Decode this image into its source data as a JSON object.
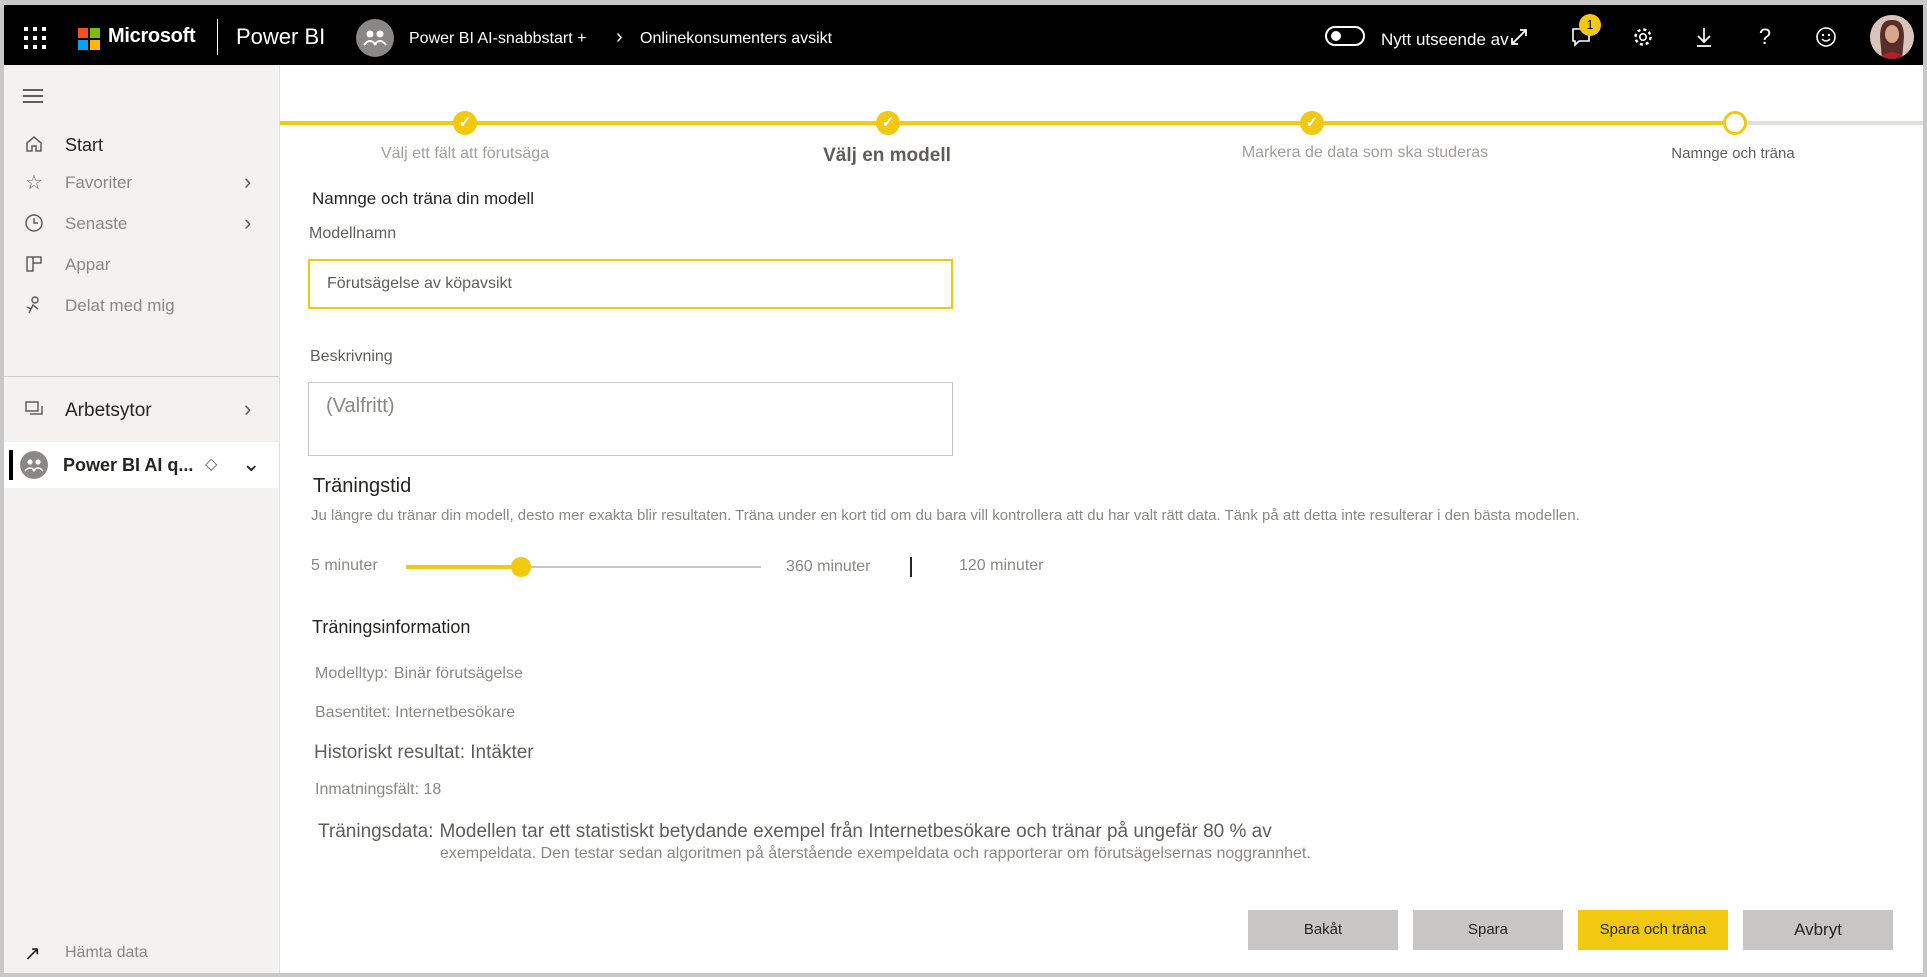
{
  "topbar": {
    "brand": "Microsoft",
    "product": "Power BI",
    "workspace": "Power BI AI-snabbstart +",
    "breadcrumb_current": "Onlinekonsumenters avsikt",
    "toggle_label": "Nytt utseende av",
    "notification_count": "1"
  },
  "sidebar": {
    "items": [
      {
        "label": "Start"
      },
      {
        "label": "Favoriter"
      },
      {
        "label": "Senaste"
      },
      {
        "label": "Appar"
      },
      {
        "label": "Delat med mig"
      },
      {
        "label": "Arbetsytor"
      }
    ],
    "current_workspace": "Power BI AI q...",
    "get_data": "Hämta data"
  },
  "stepper": {
    "steps": [
      {
        "label": "Välj ett fält att förutsäga",
        "state": "done"
      },
      {
        "label": "Välj en modell",
        "state": "done"
      },
      {
        "label": "Markera de data som ska studeras",
        "state": "done"
      },
      {
        "label": "Namnge och träna",
        "state": "current"
      }
    ]
  },
  "form": {
    "section_title": "Namnge och träna din modell",
    "model_name_label": "Modellnamn",
    "model_name_value": "Förutsägelse  av köpavsikt",
    "description_label": "Beskrivning",
    "description_placeholder": "(Valfritt)"
  },
  "training_time": {
    "title": "Träningstid",
    "description": "Ju längre du tränar din modell, desto mer exakta blir resultaten. Träna under en kort tid om du bara vill kontrollera att du har valt rätt data. Tänk på att detta inte resulterar i den bästa modellen.",
    "min_label": "5 minuter",
    "max_label": "360 minuter",
    "value_label": "120 minuter",
    "min": 5,
    "max": 360,
    "value": 120
  },
  "training_info": {
    "title": "Träningsinformation",
    "model_type_key": "Modelltyp:",
    "model_type_value": "Binär förutsägelse",
    "base_entity": "Basentitet: Internetbesökare",
    "historical_title": "Historiskt resultat: Intäkter",
    "input_fields": "Inmatningsfält: 18",
    "training_data_key": "Träningsdata:",
    "training_data_line1": "Modellen tar ett statistiskt betydande exempel från Internetbesökare och tränar på ungefär 80 % av",
    "training_data_line2": "exempeldata. Den testar sedan algoritmen på återstående exempeldata och rapporterar om förutsägelsernas noggrannhet."
  },
  "buttons": {
    "back": "Bakåt",
    "save": "Spara",
    "save_train": "Spara och träna",
    "cancel": "Avbryt"
  },
  "colors": {
    "accent": "#f2c811",
    "topbar": "#000000",
    "sidebar": "#f3f2f1"
  }
}
